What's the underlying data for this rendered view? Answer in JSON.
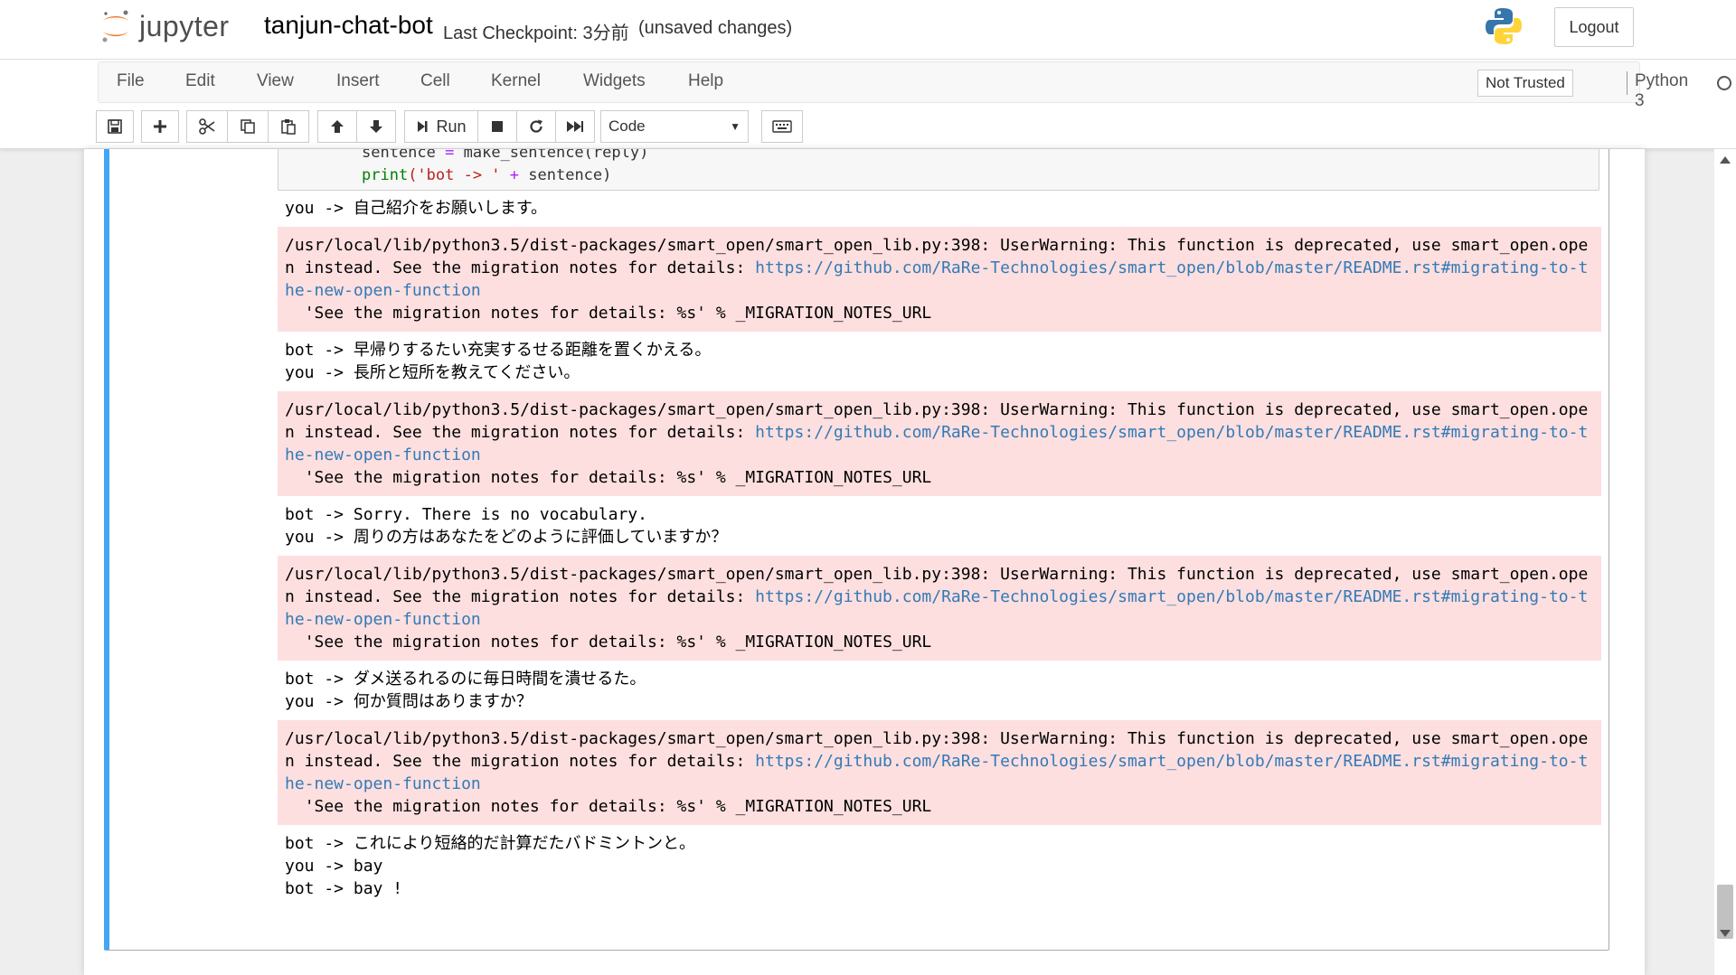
{
  "header": {
    "logo_text": "jupyter",
    "notebook_name": "tanjun-chat-bot",
    "checkpoint": "Last Checkpoint: 3分前",
    "autosave": "(unsaved changes)",
    "logout_label": "Logout"
  },
  "menu": {
    "items": [
      "File",
      "Edit",
      "View",
      "Insert",
      "Cell",
      "Kernel",
      "Widgets",
      "Help"
    ],
    "not_trusted": "Not Trusted",
    "kernel_name": "Python 3"
  },
  "toolbar": {
    "run_label": "Run",
    "cell_type": "Code",
    "icons": [
      "save-icon",
      "plus-icon",
      "cut-icon",
      "copy-icon",
      "paste-icon",
      "arrow-up-icon",
      "arrow-down-icon",
      "step-forward-icon",
      "stop-icon",
      "restart-icon",
      "fast-forward-icon",
      "keyboard-icon"
    ]
  },
  "cell": {
    "code_lines": [
      {
        "a": "sentence ",
        "b": "=",
        "c": " make_sentence(reply)"
      },
      {
        "a": "print",
        "b": "('bot -> '",
        "c": " + ",
        "d": "sentence)"
      }
    ],
    "outputs": [
      {
        "type": "plain",
        "text": "you -> 自己紹介をお願いします。"
      },
      {
        "type": "error",
        "pre": "/usr/local/lib/python3.5/dist-packages/smart_open/smart_open_lib.py:398: UserWarning: This function is deprecated, use smart_open.open instead. See the migration notes for details: ",
        "link": "https://github.com/RaRe-Technologies/smart_open/blob/master/README.rst#migrating-to-the-new-open-function",
        "post": "\n  'See the migration notes for details: %s' % _MIGRATION_NOTES_URL"
      },
      {
        "type": "plain",
        "text": "bot -> 早帰りするたい充実するせる距離を置くかえる。\nyou -> 長所と短所を教えてください。"
      },
      {
        "type": "error",
        "pre": "/usr/local/lib/python3.5/dist-packages/smart_open/smart_open_lib.py:398: UserWarning: This function is deprecated, use smart_open.open instead. See the migration notes for details: ",
        "link": "https://github.com/RaRe-Technologies/smart_open/blob/master/README.rst#migrating-to-the-new-open-function",
        "post": "\n  'See the migration notes for details: %s' % _MIGRATION_NOTES_URL"
      },
      {
        "type": "plain",
        "text": "bot -> Sorry. There is no vocabulary.\nyou -> 周りの方はあなたをどのように評価していますか？"
      },
      {
        "type": "error",
        "pre": "/usr/local/lib/python3.5/dist-packages/smart_open/smart_open_lib.py:398: UserWarning: This function is deprecated, use smart_open.open instead. See the migration notes for details: ",
        "link": "https://github.com/RaRe-Technologies/smart_open/blob/master/README.rst#migrating-to-the-new-open-function",
        "post": "\n  'See the migration notes for details: %s' % _MIGRATION_NOTES_URL"
      },
      {
        "type": "plain",
        "text": "bot -> ダメ送るれるのに毎日時間を潰せるた。\nyou -> 何か質問はありますか？"
      },
      {
        "type": "error",
        "pre": "/usr/local/lib/python3.5/dist-packages/smart_open/smart_open_lib.py:398: UserWarning: This function is deprecated, use smart_open.open instead. See the migration notes for details: ",
        "link": "https://github.com/RaRe-Technologies/smart_open/blob/master/README.rst#migrating-to-the-new-open-function",
        "post": "\n  'See the migration notes for details: %s' % _MIGRATION_NOTES_URL"
      },
      {
        "type": "plain",
        "text": "bot -> これにより短絡的だ計算だたバドミントンと。\nyou -> bay\nbot -> bay !"
      }
    ]
  },
  "colors": {
    "accent_border": "#42a5f5",
    "error_bg": "#fddfdf",
    "link": "#337ab7"
  }
}
